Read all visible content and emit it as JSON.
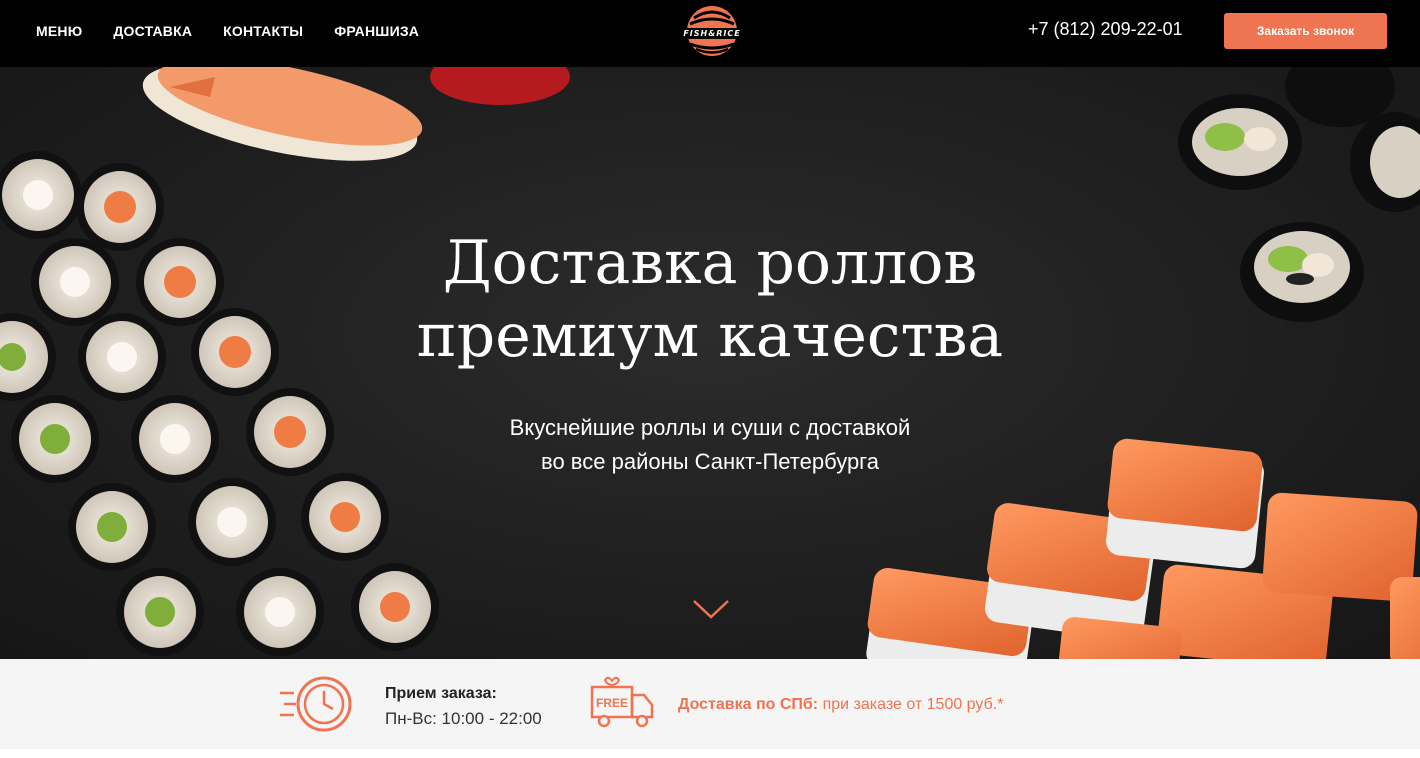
{
  "header": {
    "nav": [
      {
        "label": "МЕНЮ"
      },
      {
        "label": "ДОСТАВКА"
      },
      {
        "label": "КОНТАКТЫ"
      },
      {
        "label": "ФРАНШИЗА"
      }
    ],
    "logo_text": "FISH&RICE",
    "phone": "+7 (812) 209-22-01",
    "callback_label": "Заказать звонок"
  },
  "hero": {
    "title_line1": "Доставка роллов",
    "title_line2": "премиум качества",
    "subtitle_line1": "Вкуснейшие роллы и суши с доставкой",
    "subtitle_line2": "во все районы Санкт-Петербурга",
    "scroll_icon": "chevron-down-icon"
  },
  "info": {
    "hours_title": "Прием заказа:",
    "hours_value": "Пн-Вс: 10:00 - 22:00",
    "delivery_label": "Доставка по СПб:",
    "delivery_text": " при заказе от 1500 руб.*",
    "truck_badge": "FREE"
  },
  "colors": {
    "accent": "#ef7451",
    "header_bg": "#000000",
    "infobar_bg": "#f5f5f5"
  }
}
